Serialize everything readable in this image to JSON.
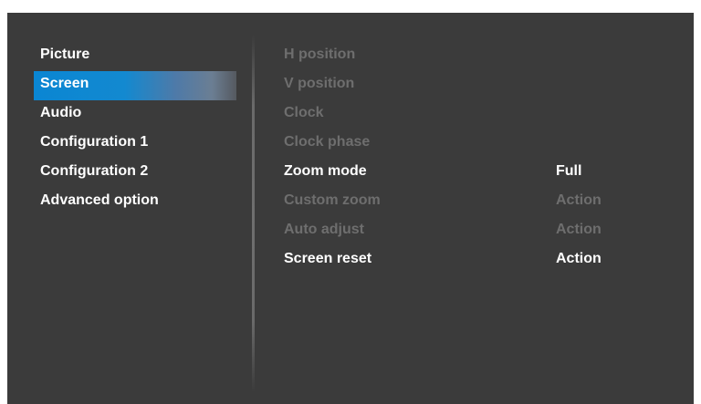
{
  "sidebar": {
    "items": [
      {
        "label": "Picture"
      },
      {
        "label": "Screen"
      },
      {
        "label": "Audio"
      },
      {
        "label": "Configuration 1"
      },
      {
        "label": "Configuration 2"
      },
      {
        "label": "Advanced option"
      }
    ],
    "selected": "Screen"
  },
  "settings": {
    "rows": [
      {
        "label": "H position",
        "value": "",
        "enabled": false
      },
      {
        "label": "V position",
        "value": "",
        "enabled": false
      },
      {
        "label": "Clock",
        "value": "",
        "enabled": false
      },
      {
        "label": "Clock phase",
        "value": "",
        "enabled": false
      },
      {
        "label": "Zoom mode",
        "value": "Full",
        "enabled": true
      },
      {
        "label": "Custom zoom",
        "value": "Action",
        "enabled": false
      },
      {
        "label": "Auto adjust",
        "value": "Action",
        "enabled": false
      },
      {
        "label": "Screen reset",
        "value": "Action",
        "enabled": true
      }
    ]
  },
  "colors": {
    "background": "#3b3b3b",
    "selected_highlight": "#0a86d3",
    "text_enabled": "#ffffff",
    "text_disabled": "#6e6e6e"
  }
}
